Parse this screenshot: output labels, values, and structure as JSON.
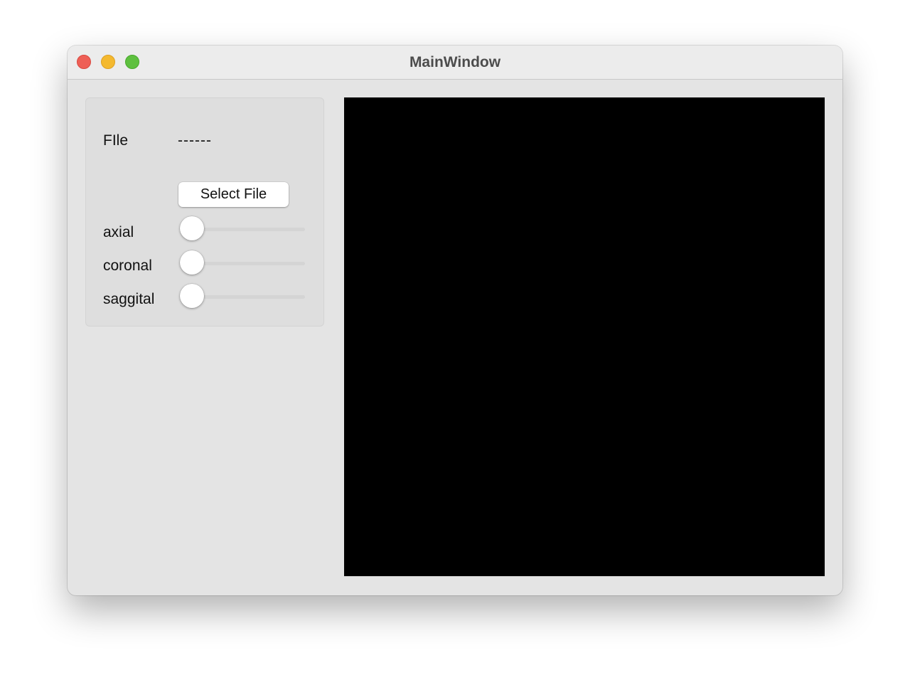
{
  "window": {
    "title": "MainWindow"
  },
  "panel": {
    "file_label": "FIle",
    "file_value": "------",
    "select_button_label": "Select File",
    "sliders": [
      {
        "label": "axial",
        "value": 0
      },
      {
        "label": "coronal",
        "value": 0
      },
      {
        "label": "saggital",
        "value": 0
      }
    ]
  },
  "colors": {
    "close": "#ee5f56",
    "minimize": "#f4b92f",
    "zoom": "#5ec03f",
    "viewer_background": "#000000"
  }
}
